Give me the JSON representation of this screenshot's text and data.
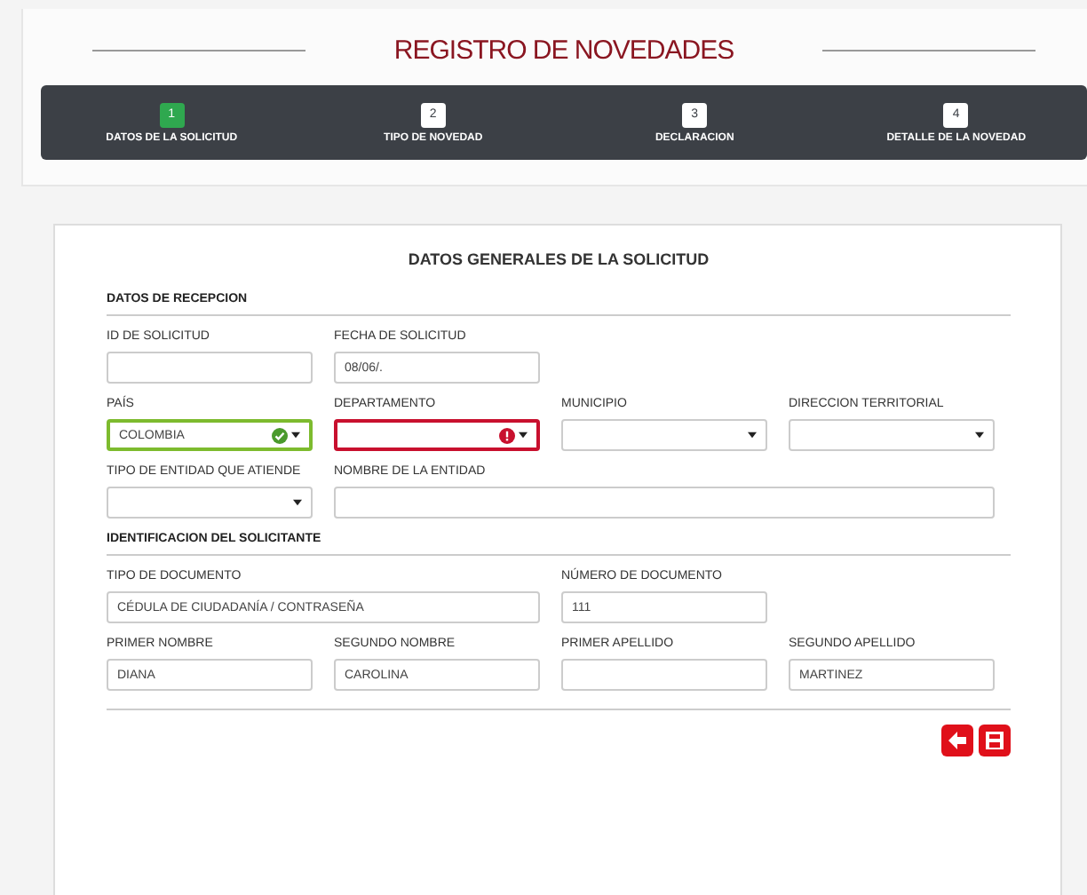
{
  "title": "REGISTRO DE NOVEDADES",
  "steps": [
    {
      "number": "1",
      "label": "DATOS DE LA SOLICITUD",
      "selected": true
    },
    {
      "number": "2",
      "label": "TIPO DE NOVEDAD",
      "selected": false
    },
    {
      "number": "3",
      "label": "DECLARACION",
      "selected": false
    },
    {
      "number": "4",
      "label": "DETALLE DE LA NOVEDAD",
      "selected": false
    }
  ],
  "form": {
    "title": "DATOS GENERALES DE LA SOLICITUD",
    "sections": [
      {
        "title": "DATOS DE RECEPCION",
        "lines": [
          {
            "fields": [
              {
                "label": "ID DE SOLICITUD",
                "kind": "text",
                "valid": false,
                "error": false
              },
              {
                "label": "FECHA DE SOLICITUD",
                "kind": "text",
                "value": "08/06/.",
                "valid": false,
                "error": false
              }
            ]
          },
          {
            "fields": [
              {
                "label": "PAÍS",
                "kind": "select",
                "value": "COLOMBIA",
                "valid": true,
                "error": false
              },
              {
                "label": "DEPARTAMENTO",
                "kind": "select",
                "valid": false,
                "error": true
              },
              {
                "label": "MUNICIPIO",
                "kind": "select",
                "valid": false,
                "error": false
              },
              {
                "label": "DIRECCION TERRITORIAL",
                "kind": "select",
                "valid": false,
                "error": false
              }
            ]
          },
          {
            "fields": [
              {
                "label": "TIPO DE ENTIDAD QUE ATIENDE",
                "kind": "select",
                "valid": false,
                "error": false
              },
              {
                "label": "NOMBRE DE LA ENTIDAD",
                "kind": "long_text",
                "valid": false,
                "error": false
              }
            ]
          }
        ]
      },
      {
        "title": "IDENTIFICACION DEL SOLICITANTE",
        "lines": [
          {
            "fields": [
              {
                "label": "TIPO DE DOCUMENTO",
                "kind": "long_text",
                "value": "CÉDULA DE CIUDADANÍA / CONTRASEÑA",
                "valid": false,
                "error": false
              },
              {
                "label": "NÚMERO DE DOCUMENTO",
                "kind": "text",
                "value": "111",
                "valid": false,
                "error": false
              }
            ]
          },
          {
            "fields": [
              {
                "label": "PRIMER NOMBRE",
                "kind": "text",
                "value": "DIANA",
                "valid": false,
                "error": false
              },
              {
                "label": "SEGUNDO NOMBRE",
                "kind": "text",
                "value": "CAROLINA",
                "valid": false,
                "error": false
              },
              {
                "label": "PRIMER APELLIDO",
                "kind": "text",
                "valid": false,
                "error": false
              },
              {
                "label": "SEGUNDO APELLIDO",
                "kind": "text",
                "value": "MARTINEZ",
                "valid": false,
                "error": false
              }
            ]
          }
        ]
      }
    ]
  }
}
